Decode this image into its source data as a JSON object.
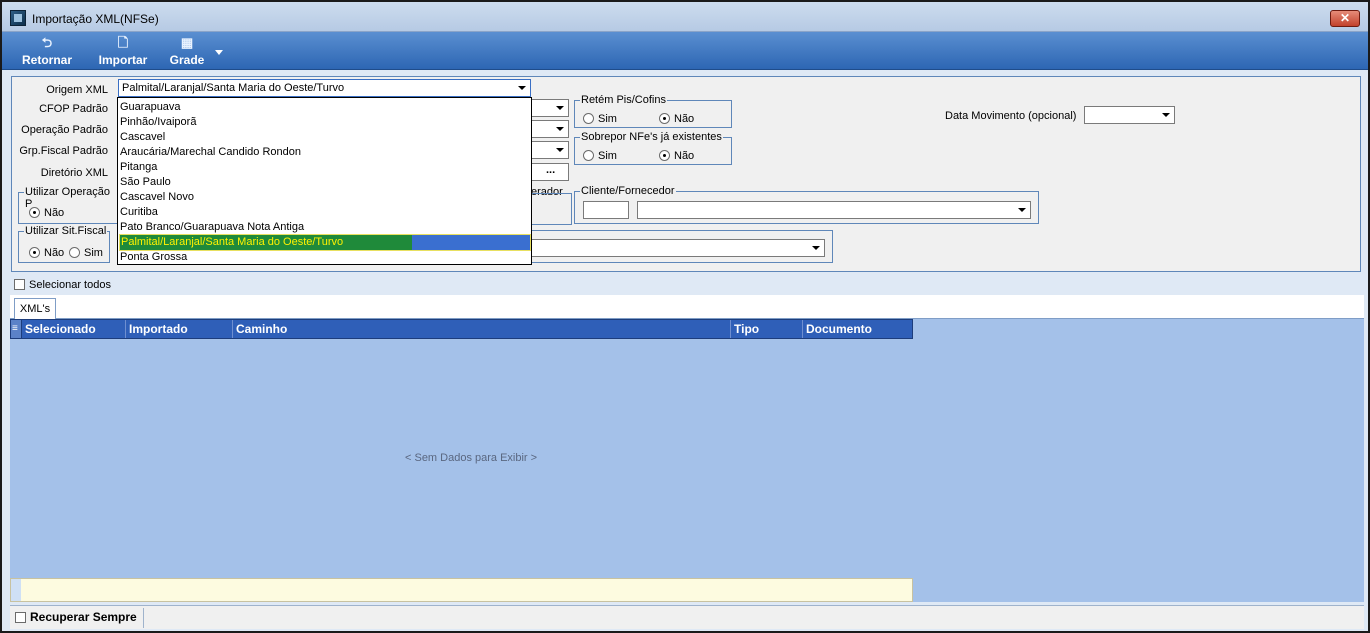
{
  "window": {
    "title": "Importação XML(NFSe)",
    "close_label": "✕"
  },
  "toolbar": {
    "retornar": "Retornar",
    "importar": "Importar",
    "grade": "Grade"
  },
  "form": {
    "origem_label": "Origem XML",
    "origem_value": "Palmital/Laranjal/Santa Maria do Oeste/Turvo",
    "cfop_label": "CFOP Padrão",
    "operacao_label": "Operação Padrão",
    "grp_fiscal_label": "Grp.Fiscal Padrão",
    "diretorio_label": "Diretório XML",
    "diretorio_button": "...",
    "utilizar_operacao_title": "Utilizar Operação P",
    "utilizar_operacao_nao": "Não",
    "utilizar_sit_title": "Utilizar Sit.Fiscal",
    "utilizar_sit_nao": "Não",
    "utilizar_sit_sim": "Sim",
    "retem_title": "Retém Pis/Cofins",
    "retem_sim": "Sim",
    "retem_nao": "Não",
    "sobrepor_title": "Sobrepor NFe's já existentes",
    "sobrepor_sim": "Sim",
    "sobrepor_nao": "Não",
    "operador_partial": "erador",
    "cliente_title": "Cliente/Fornecedor",
    "data_mov_label": "Data Movimento (opcional)"
  },
  "dropdown": {
    "items": [
      "Guarapuava",
      "Pinhão/Ivaiporã",
      "Cascavel",
      "Araucária/Marechal Candido Rondon",
      "Pitanga",
      "São Paulo",
      "Cascavel Novo",
      "Curitiba",
      "Pato Branco/Guarapuava Nota Antiga",
      "Palmital/Laranjal/Santa Maria do Oeste/Turvo",
      "Ponta Grossa"
    ],
    "selected_index": 9
  },
  "select_all_label": "Selecionar todos",
  "tabs": {
    "xmls": "XML's"
  },
  "grid": {
    "columns": [
      "Selecionado",
      "Importado",
      "Caminho",
      "Tipo",
      "Documento"
    ],
    "empty_message": "< Sem Dados para Exibir >"
  },
  "status": {
    "recuperar": "Recuperar Sempre"
  },
  "colors": {
    "toolbar": "#3a74c2",
    "grid_header": "#2f5fb8",
    "grid_bg": "#a4c1e9",
    "highlight": "#1f8a3a"
  }
}
